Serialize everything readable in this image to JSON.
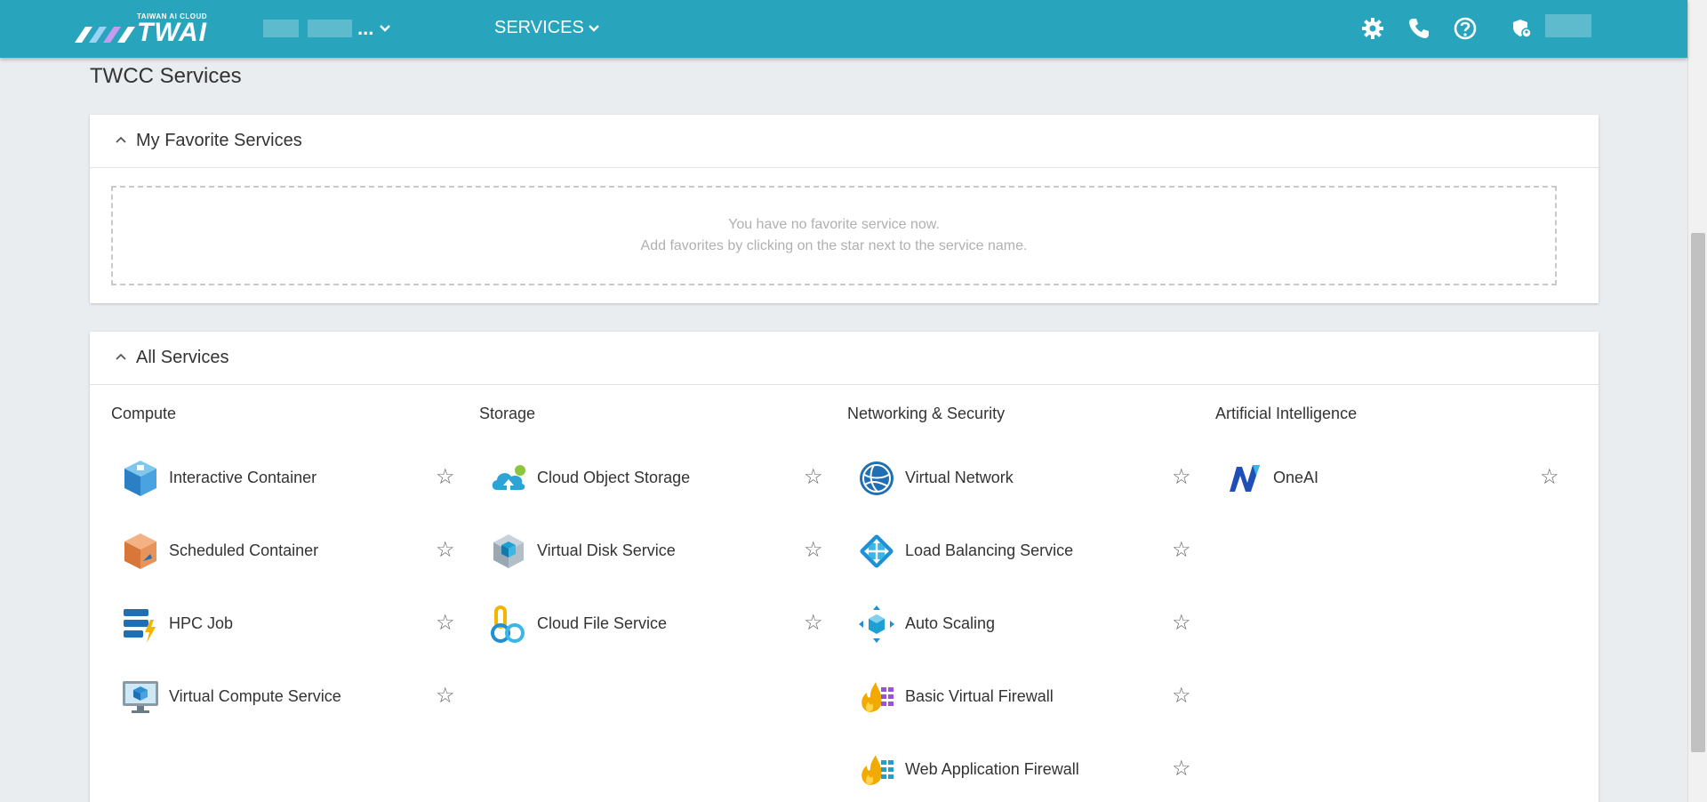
{
  "header": {
    "logo_small": "TAIWAN AI CLOUD",
    "logo_big": "TWAI",
    "project_ellipsis": "...",
    "services_label": "SERVICES",
    "icons": [
      "gear-icon",
      "phone-icon",
      "help-icon",
      "shield-user-icon"
    ]
  },
  "page": {
    "title": "TWCC Services"
  },
  "favorites": {
    "title": "My Favorite Services",
    "empty_line1": "You have no favorite service now.",
    "empty_line2": "Add favorites by clicking on the star next to the service name."
  },
  "all_services": {
    "title": "All Services",
    "columns": [
      {
        "title": "Compute",
        "items": [
          {
            "name": "Interactive Container",
            "icon": "interactive-container-icon"
          },
          {
            "name": "Scheduled Container",
            "icon": "scheduled-container-icon"
          },
          {
            "name": "HPC Job",
            "icon": "hpc-job-icon"
          },
          {
            "name": "Virtual Compute Service",
            "icon": "virtual-compute-icon"
          }
        ]
      },
      {
        "title": "Storage",
        "items": [
          {
            "name": "Cloud Object Storage",
            "icon": "cloud-object-storage-icon"
          },
          {
            "name": "Virtual Disk Service",
            "icon": "virtual-disk-icon"
          },
          {
            "name": "Cloud File Service",
            "icon": "cloud-file-icon"
          }
        ]
      },
      {
        "title": "Networking & Security",
        "items": [
          {
            "name": "Virtual Network",
            "icon": "virtual-network-icon"
          },
          {
            "name": "Load Balancing Service",
            "icon": "load-balancing-icon"
          },
          {
            "name": "Auto Scaling",
            "icon": "auto-scaling-icon"
          },
          {
            "name": "Basic Virtual Firewall",
            "icon": "basic-firewall-icon"
          },
          {
            "name": "Web Application Firewall",
            "icon": "waf-icon"
          }
        ]
      },
      {
        "title": "Artificial Intelligence",
        "items": [
          {
            "name": "OneAI",
            "icon": "oneai-icon"
          }
        ]
      }
    ]
  },
  "star_glyph": "☆",
  "colors": {
    "header_bg": "#28a5bd",
    "page_bg": "#e9edf0"
  }
}
